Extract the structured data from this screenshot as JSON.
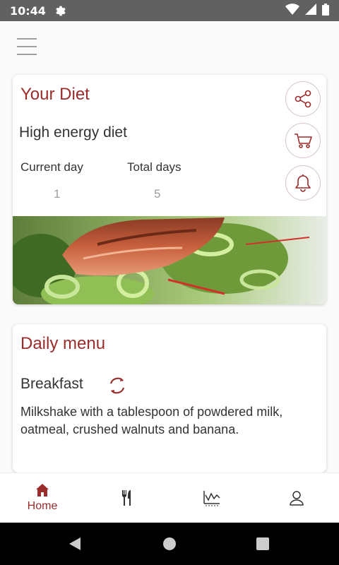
{
  "status_bar": {
    "time": "10:44"
  },
  "diet_card": {
    "title": "Your Diet",
    "diet_name": "High energy diet",
    "current_day_label": "Current day",
    "current_day_value": "1",
    "total_days_label": "Total days",
    "total_days_value": "5"
  },
  "menu_card": {
    "title": "Daily menu",
    "meal_name": "Breakfast",
    "meal_description": "Milkshake with a tablespoon of powdered milk, oatmeal, crushed walnuts and banana."
  },
  "bottom_nav": {
    "items": [
      {
        "label": "Home",
        "icon": "home-icon",
        "active": true
      },
      {
        "label": "",
        "icon": "fork-knife-icon",
        "active": false
      },
      {
        "label": "",
        "icon": "chart-icon",
        "active": false
      },
      {
        "label": "",
        "icon": "profile-icon",
        "active": false
      }
    ]
  },
  "colors": {
    "accent": "#9b2c2c",
    "status_bar": "#616161"
  }
}
